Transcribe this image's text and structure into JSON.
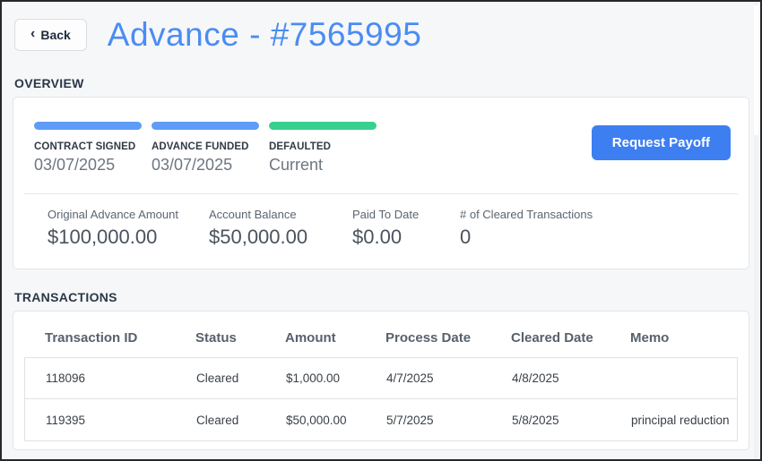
{
  "page": {
    "back_label": "Back",
    "title": "Advance - #7565995"
  },
  "overview": {
    "section_label": "OVERVIEW",
    "milestones": [
      {
        "label": "CONTRACT SIGNED",
        "value": "03/07/2025",
        "bar_color": "#5e9cf7"
      },
      {
        "label": "ADVANCE FUNDED",
        "value": "03/07/2025",
        "bar_color": "#5e9cf7"
      },
      {
        "label": "DEFAULTED",
        "value": "Current",
        "bar_color": "#38d08e"
      }
    ],
    "request_payoff_label": "Request Payoff",
    "stats": [
      {
        "label": "Original Advance Amount",
        "value": "$100,000.00"
      },
      {
        "label": "Account Balance",
        "value": "$50,000.00"
      },
      {
        "label": "Paid To Date",
        "value": "$0.00"
      },
      {
        "label": "# of Cleared Transactions",
        "value": "0"
      }
    ]
  },
  "transactions": {
    "section_label": "TRANSACTIONS",
    "columns": [
      "Transaction ID",
      "Status",
      "Amount",
      "Process Date",
      "Cleared Date",
      "Memo"
    ],
    "rows": [
      {
        "transaction_id": "118096",
        "status": "Cleared",
        "amount": "$1,000.00",
        "process_date": "4/7/2025",
        "cleared_date": "4/8/2025",
        "memo": ""
      },
      {
        "transaction_id": "119395",
        "status": "Cleared",
        "amount": "$50,000.00",
        "process_date": "5/7/2025",
        "cleared_date": "5/8/2025",
        "memo": "principal reduction"
      }
    ]
  },
  "icons": {
    "back_chevron": "‹"
  },
  "colors": {
    "title_blue": "#4a8cf3",
    "button_blue": "#3d7ff0",
    "bar_blue": "#5e9cf7",
    "bar_green": "#38d08e",
    "page_background": "#f6f7f9"
  }
}
